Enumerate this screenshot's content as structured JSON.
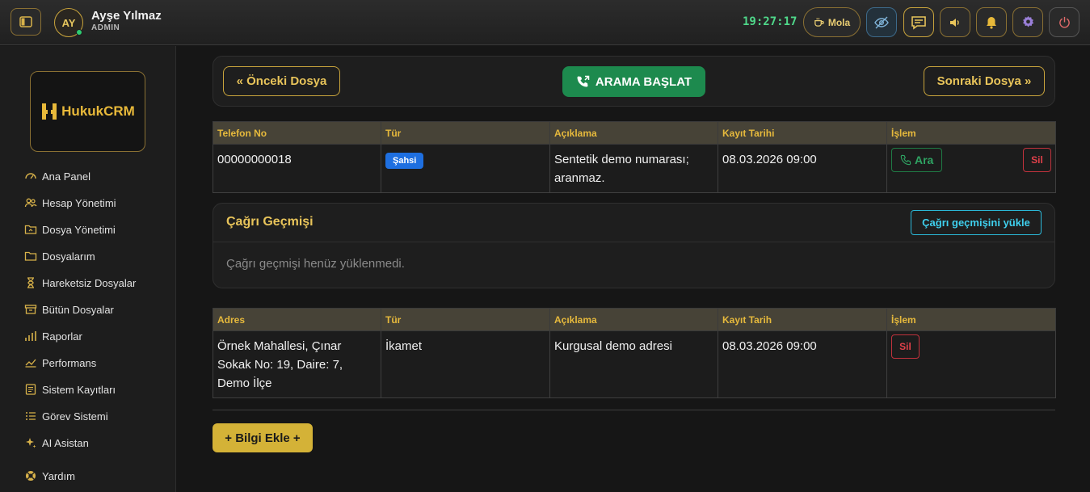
{
  "topbar": {
    "user_initials": "AY",
    "user_name": "Ayşe Yılmaz",
    "user_role": "ADMIN",
    "clock": "19:27:17",
    "mola_label": "Mola"
  },
  "sidebar": {
    "logo_text": "HukukCRM",
    "items": [
      {
        "label": "Ana Panel",
        "icon": "dashboard-icon"
      },
      {
        "label": "Hesap Yönetimi",
        "icon": "users-icon"
      },
      {
        "label": "Dosya Yönetimi",
        "icon": "folder-open-icon"
      },
      {
        "label": "Dosyalarım",
        "icon": "folder-icon"
      },
      {
        "label": "Hareketsiz Dosyalar",
        "icon": "hourglass-icon"
      },
      {
        "label": "Bütün Dosyalar",
        "icon": "archive-icon"
      },
      {
        "label": "Raporlar",
        "icon": "bar-chart-icon"
      },
      {
        "label": "Performans",
        "icon": "trend-icon"
      },
      {
        "label": "Sistem Kayıtları",
        "icon": "log-icon"
      },
      {
        "label": "Görev Sistemi",
        "icon": "task-list-icon"
      },
      {
        "label": "AI Asistan",
        "icon": "sparkle-icon"
      },
      {
        "label": "Yardım",
        "icon": "lifebuoy-icon"
      }
    ]
  },
  "nav": {
    "prev_label": "« Önceki Dosya",
    "call_label": "ARAMA BAŞLAT",
    "next_label": "Sonraki Dosya »"
  },
  "phones": {
    "headers": [
      "Telefon No",
      "Tür",
      "Açıklama",
      "Kayıt Tarihi",
      "İşlem"
    ],
    "rows": [
      {
        "number": "00000000018",
        "type": "Şahsi",
        "description": "Sentetik demo numarası; aranmaz.",
        "date": "08.03.2026 09:00",
        "call_label": "Ara",
        "delete_label": "Sil"
      }
    ]
  },
  "history": {
    "title": "Çağrı Geçmişi",
    "load_label": "Çağrı geçmişini yükle",
    "empty_text": "Çağrı geçmişi henüz yüklenmedi."
  },
  "addresses": {
    "headers": [
      "Adres",
      "Tür",
      "Açıklama",
      "Kayıt Tarih",
      "İşlem"
    ],
    "rows": [
      {
        "address": "Örnek Mahallesi, Çınar Sokak No: 19, Daire: 7, Demo İlçe",
        "type": "İkamet",
        "description": "Kurgusal demo adresi",
        "date": "08.03.2026 09:00",
        "delete_label": "Sil"
      }
    ]
  },
  "add_info_label": "+ Bilgi Ekle +",
  "colors": {
    "accent_gold": "#e6b93c",
    "call_green": "#1d8a4e",
    "badge_blue": "#1e6fe0",
    "danger_red": "#e0404a",
    "clock_green": "#4fd88a"
  }
}
